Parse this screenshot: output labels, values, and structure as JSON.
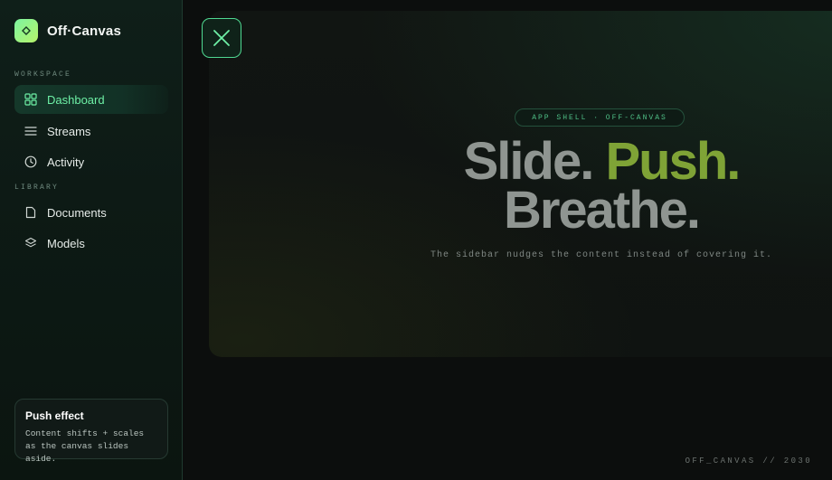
{
  "brand": {
    "name": "Off·Canvas",
    "logo_icon": "diamond-icon",
    "accent": "#7cf5a0"
  },
  "sidebar": {
    "sections": [
      {
        "label": "WORKSPACE",
        "items": [
          {
            "label": "Dashboard",
            "icon": "grid-icon",
            "active": true
          },
          {
            "label": "Streams",
            "icon": "menu-lines-icon",
            "active": false
          },
          {
            "label": "Activity",
            "icon": "clock-icon",
            "active": false
          }
        ]
      },
      {
        "label": "LIBRARY",
        "items": [
          {
            "label": "Documents",
            "icon": "document-icon",
            "active": false
          },
          {
            "label": "Models",
            "icon": "layers-icon",
            "active": false
          }
        ]
      }
    ],
    "card": {
      "title": "Push effect",
      "description": "Content shifts + scales as the canvas slides aside."
    }
  },
  "main": {
    "close_icon": "close-icon",
    "pill": "APP SHELL · OFF-CANVAS",
    "headline": {
      "word1": "Slide.",
      "word2": "Push.",
      "word3": "Breathe."
    },
    "subline": "The sidebar nudges the content instead of covering it.",
    "accent_color": "#7fa336"
  },
  "footer": {
    "text": "OFF_CANVAS // 2030"
  }
}
